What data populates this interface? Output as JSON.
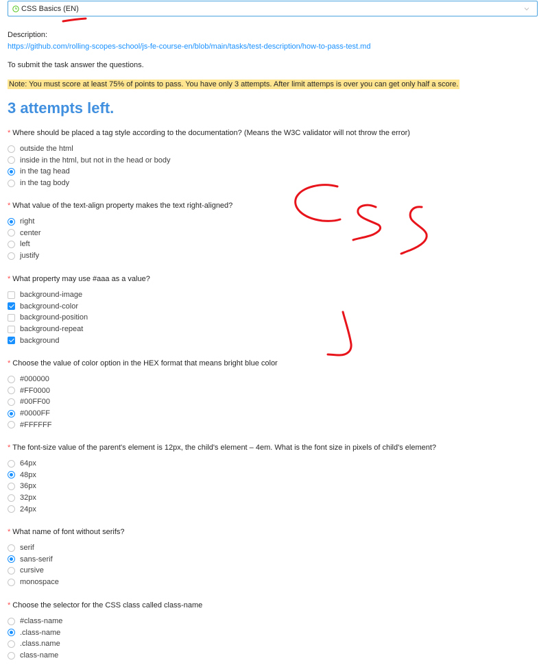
{
  "course_select": {
    "value": "CSS Basics (EN)"
  },
  "description": {
    "label": "Description:",
    "link": "https://github.com/rolling-scopes-school/js-fe-course-en/blob/main/tasks/test-description/how-to-pass-test.md"
  },
  "submit_text": "To submit the task answer the questions.",
  "note": "Note: You must score at least 75% of points to pass. You have only 3 attempts. After limit attemps is over you can get only half a score.",
  "attempts_left": "3 attempts left.",
  "required_mark": "*",
  "questions": [
    {
      "text": "Where should be placed a tag style according to the documentation? (Means the W3C validator will not throw the error)",
      "type": "radio",
      "options": [
        {
          "label": "outside the html",
          "checked": false
        },
        {
          "label": "inside in the html, but not in the head or body",
          "checked": false
        },
        {
          "label": "in the tag head",
          "checked": true
        },
        {
          "label": "in the tag body",
          "checked": false
        }
      ]
    },
    {
      "text": "What value of the text-align property makes the text right-aligned?",
      "type": "radio",
      "options": [
        {
          "label": "right",
          "checked": true
        },
        {
          "label": "center",
          "checked": false
        },
        {
          "label": "left",
          "checked": false
        },
        {
          "label": "justify",
          "checked": false
        }
      ]
    },
    {
      "text": "What property may use #aaa as a value?",
      "type": "checkbox",
      "options": [
        {
          "label": "background-image",
          "checked": false
        },
        {
          "label": "background-color",
          "checked": true
        },
        {
          "label": "background-position",
          "checked": false
        },
        {
          "label": "background-repeat",
          "checked": false
        },
        {
          "label": "background",
          "checked": true
        }
      ]
    },
    {
      "text": "Choose the value of color option in the HEX format that means bright blue color",
      "type": "radio",
      "options": [
        {
          "label": "#000000",
          "checked": false
        },
        {
          "label": "#FF0000",
          "checked": false
        },
        {
          "label": "#00FF00",
          "checked": false
        },
        {
          "label": "#0000FF",
          "checked": true
        },
        {
          "label": "#FFFFFF",
          "checked": false
        }
      ]
    },
    {
      "text": "The font-size value of the parent's element is 12px, the child's element – 4em. What is the font size in pixels of child's element?",
      "type": "radio",
      "options": [
        {
          "label": "64px",
          "checked": false
        },
        {
          "label": "48px",
          "checked": true
        },
        {
          "label": "36px",
          "checked": false
        },
        {
          "label": "32px",
          "checked": false
        },
        {
          "label": "24px",
          "checked": false
        }
      ]
    },
    {
      "text": "What name of font without serifs?",
      "type": "radio",
      "options": [
        {
          "label": "serif",
          "checked": false
        },
        {
          "label": "sans-serif",
          "checked": true
        },
        {
          "label": "cursive",
          "checked": false
        },
        {
          "label": "monospace",
          "checked": false
        }
      ]
    },
    {
      "text": "Choose the selector for the CSS class called class-name",
      "type": "radio",
      "options": [
        {
          "label": "#class-name",
          "checked": false
        },
        {
          "label": ".class-name",
          "checked": true
        },
        {
          "label": ".class.name",
          "checked": false
        },
        {
          "label": "class-name",
          "checked": false
        }
      ]
    }
  ],
  "colors": {
    "accent": "#1890ff",
    "heading": "#4190e0",
    "required": "#ff4d4f",
    "note_bg": "#ffe58f",
    "annotation": "#e8141c"
  },
  "icons": {
    "select_status": "clock-icon",
    "select_arrow": "chevron-down-icon"
  }
}
